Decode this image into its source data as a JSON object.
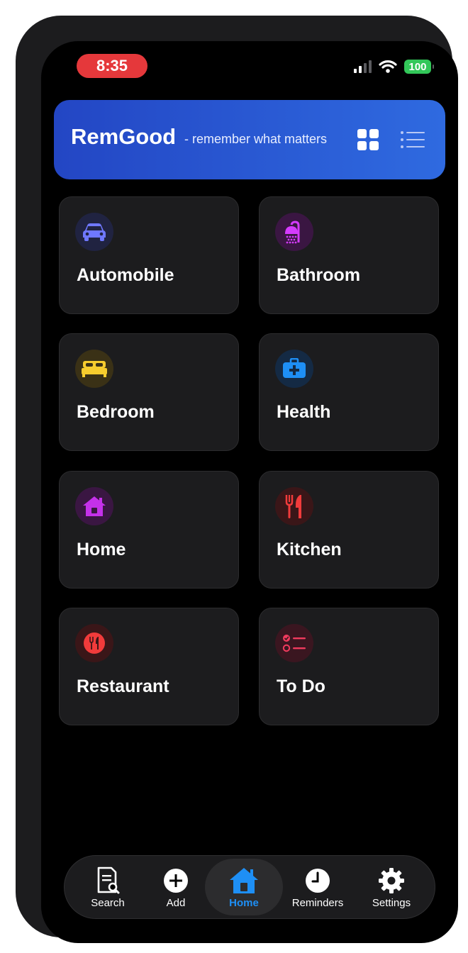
{
  "status_bar": {
    "time": "8:35",
    "battery": "100",
    "colors": {
      "time_pill": "#e5383b",
      "battery": "#32c759"
    }
  },
  "header": {
    "title": "RemGood",
    "tagline": "- remember what matters",
    "view_icons": [
      "grid-view-icon",
      "list-view-icon"
    ]
  },
  "categories": [
    {
      "label": "Automobile",
      "icon": "car-icon",
      "color": "#6f78ff"
    },
    {
      "label": "Bathroom",
      "icon": "shower-icon",
      "color": "#d53bff"
    },
    {
      "label": "Bedroom",
      "icon": "bed-icon",
      "color": "#f7cd2e"
    },
    {
      "label": "Health",
      "icon": "medical-kit-icon",
      "color": "#1e8ff5"
    },
    {
      "label": "Home",
      "icon": "house-icon",
      "color": "#c531ea"
    },
    {
      "label": "Kitchen",
      "icon": "fork-knife-icon",
      "color": "#f13b3b"
    },
    {
      "label": "Restaurant",
      "icon": "restaurant-icon",
      "color": "#f13b3b"
    },
    {
      "label": "To Do",
      "icon": "checklist-icon",
      "color": "#f13b5e"
    }
  ],
  "tabbar": {
    "tabs": [
      {
        "label": "Search",
        "icon": "search-document-icon"
      },
      {
        "label": "Add",
        "icon": "plus-circle-icon"
      },
      {
        "label": "Home",
        "icon": "house-icon",
        "active": true
      },
      {
        "label": "Reminders",
        "icon": "clock-icon"
      },
      {
        "label": "Settings",
        "icon": "gear-icon"
      }
    ],
    "active_color": "#1e8ff5"
  }
}
